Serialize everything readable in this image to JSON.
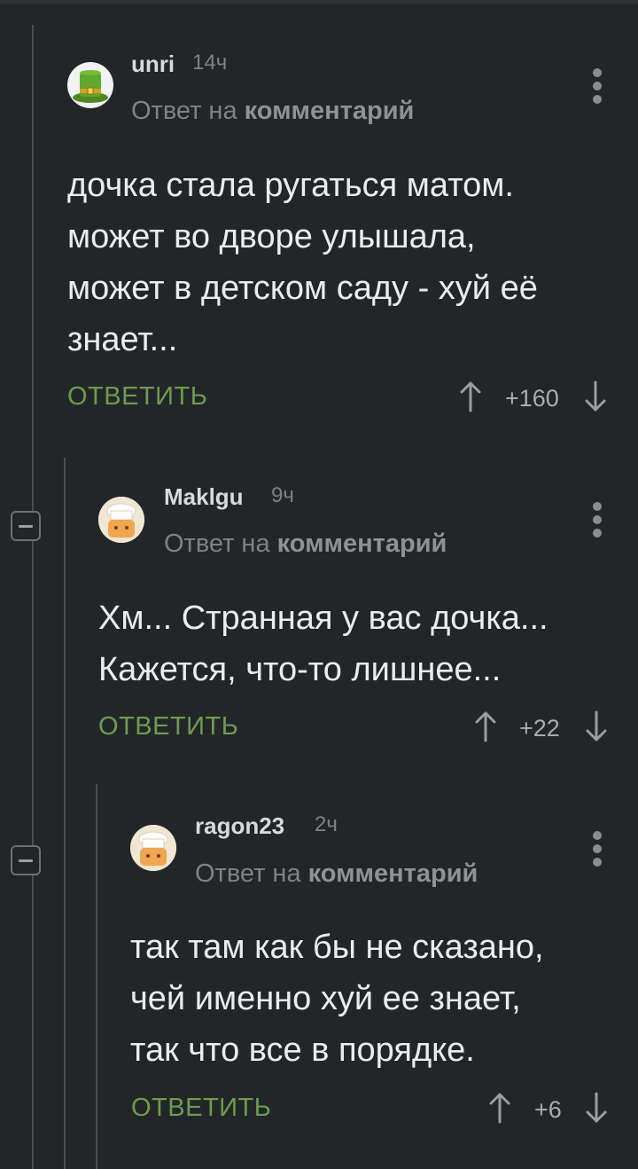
{
  "comments": [
    {
      "username": "unri",
      "time": "14ч",
      "reply_prefix": "Ответ на",
      "reply_link": "комментарий",
      "text_lines": [
        "дочка стала ругаться матом.",
        "может во дворе улышала,",
        "может в детском саду - хуй её",
        "знает..."
      ],
      "reply_label": "ОТВЕТИТЬ",
      "score": "+160",
      "avatar": "green-top-hat-avatar"
    },
    {
      "username": "Maklgu",
      "time": "9ч",
      "reply_prefix": "Ответ на",
      "reply_link": "комментарий",
      "text_lines": [
        "Хм... Странная у вас дочка...",
        "Кажется, что-то лишнее..."
      ],
      "reply_label": "ОТВЕТИТЬ",
      "score": "+22",
      "avatar": "chef-hat-avatar"
    },
    {
      "username": "ragon23",
      "time": "2ч",
      "reply_prefix": "Ответ на",
      "reply_link": "комментарий",
      "text_lines": [
        "так там как бы не сказано,",
        "чей именно хуй ее знает,",
        "так что все в порядке."
      ],
      "reply_label": "ОТВЕТИТЬ",
      "score": "+6",
      "avatar": "chef-hat-avatar"
    }
  ],
  "colors": {
    "background": "#232629",
    "reply_button": "#6e9b4e",
    "muted": "#7e8286"
  }
}
